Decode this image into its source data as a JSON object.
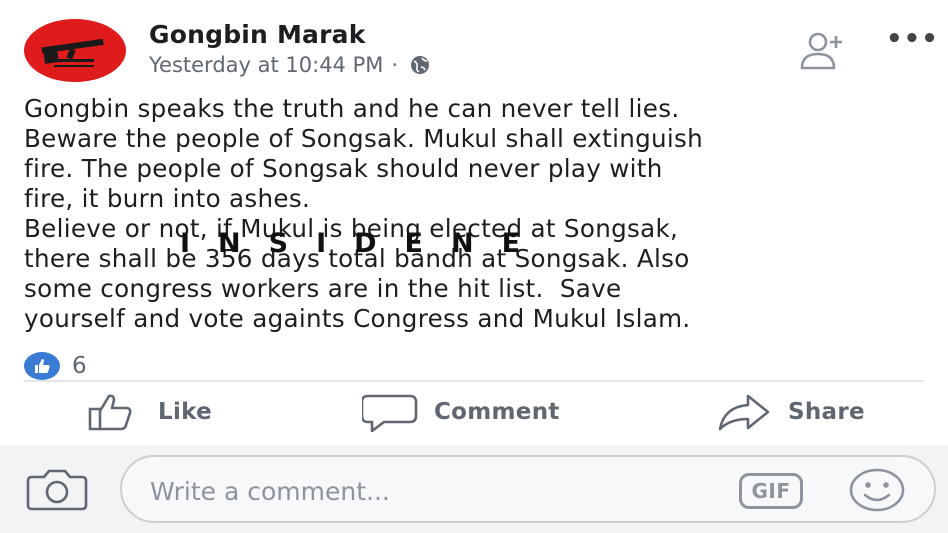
{
  "post": {
    "author": "Gongbin Marak",
    "timestamp": "Yesterday at 10:44 PM",
    "separator": "·",
    "privacy_icon": "globe-icon",
    "text": "Gongbin speaks the truth and he can never tell lies.\nBeware the people of Songsak. Mukul shall extinguish\nfire. The people of Songsak should never play with\nfire, it burn into ashes.\nBelieve or not, if Mukul is being elected at Songsak,\nthere shall be 356 days total bandh at Songsak. Also\nsome congress workers are in the hit list.  Save\nyourself and vote againts Congress and Mukul Islam.",
    "watermark": "INSIDENE",
    "reaction_count": "6"
  },
  "actions": {
    "like": "Like",
    "comment": "Comment",
    "share": "Share"
  },
  "composer": {
    "placeholder": "Write a comment...",
    "gif_label": "GIF"
  },
  "colors": {
    "like_blue": "#3a7bd5",
    "avatar_red": "#e01b1b",
    "muted": "#606770"
  }
}
